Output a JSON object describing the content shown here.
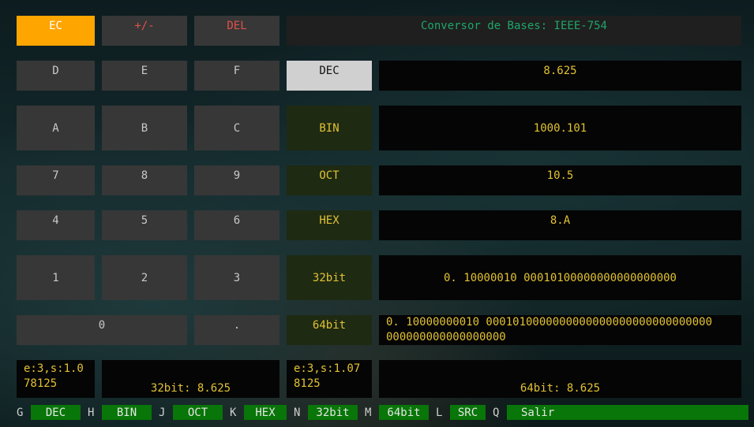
{
  "top_row": {
    "ec": "EC",
    "sign": "+/-",
    "del": "DEL",
    "title": "Conversor de Bases: IEEE-754"
  },
  "keypad": {
    "d": "D",
    "e": "E",
    "f": "F",
    "a": "A",
    "b": "B",
    "c": "C",
    "k7": "7",
    "k8": "8",
    "k9": "9",
    "k4": "4",
    "k5": "5",
    "k6": "6",
    "k1": "1",
    "k2": "2",
    "k3": "3",
    "k0": "0",
    "dot": "."
  },
  "modes": {
    "dec": {
      "label": "DEC",
      "value": "8.625"
    },
    "bin": {
      "label": "BIN",
      "value": "1000.101"
    },
    "oct": {
      "label": "OCT",
      "value": "10.5"
    },
    "hex": {
      "label": "HEX",
      "value": "8.A"
    },
    "b32": {
      "label": "32bit",
      "value": "0. 10000010 00010100000000000000000"
    },
    "b64": {
      "label": "64bit",
      "value": "0. 10000000010 0001010000000000000000000000000000\n000000000000000000"
    }
  },
  "active_mode": "DEC",
  "info_left": "e:3,s:1.0\n78125",
  "result_32": "32bit: 8.625",
  "info_right": "e:3,s:1.07\n8125",
  "result_64": "64bit: 8.625",
  "statusbar": [
    {
      "key": "G",
      "label": "DEC"
    },
    {
      "key": "H",
      "label": "BIN"
    },
    {
      "key": "J",
      "label": "OCT"
    },
    {
      "key": "K",
      "label": "HEX"
    },
    {
      "key": "N",
      "label": "32bit"
    },
    {
      "key": "M",
      "label": "64bit"
    },
    {
      "key": "L",
      "label": "SRC"
    },
    {
      "key": "Q",
      "label": "Salir"
    }
  ],
  "colors": {
    "accent": "#ffa500",
    "value_text": "#e2c233",
    "title_text": "#1fa66a",
    "status_bg": "#087608",
    "key_bg": "#373737"
  }
}
